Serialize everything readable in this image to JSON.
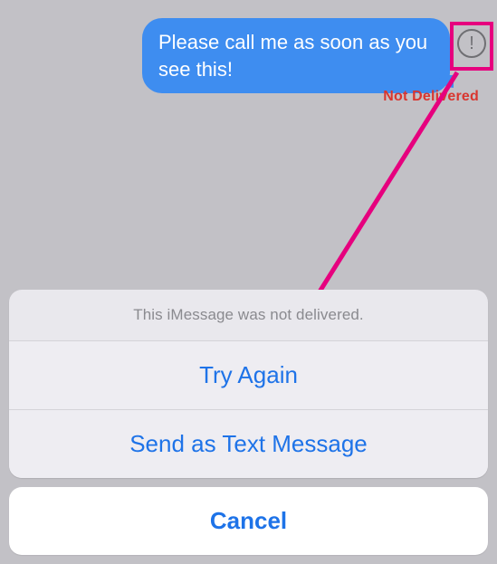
{
  "message": {
    "text": "Please call me as soon as you see this!",
    "status": "Not Delivered"
  },
  "alert_icon_glyph": "!",
  "action_sheet": {
    "header": "This iMessage was not delivered.",
    "try_again": "Try Again",
    "send_as_text": "Send as Text Message",
    "cancel": "Cancel"
  },
  "colors": {
    "bubble": "#3e8df0",
    "error_text": "#d9362f",
    "action_blue": "#1e73e8",
    "highlight_pink": "#e6007e"
  }
}
